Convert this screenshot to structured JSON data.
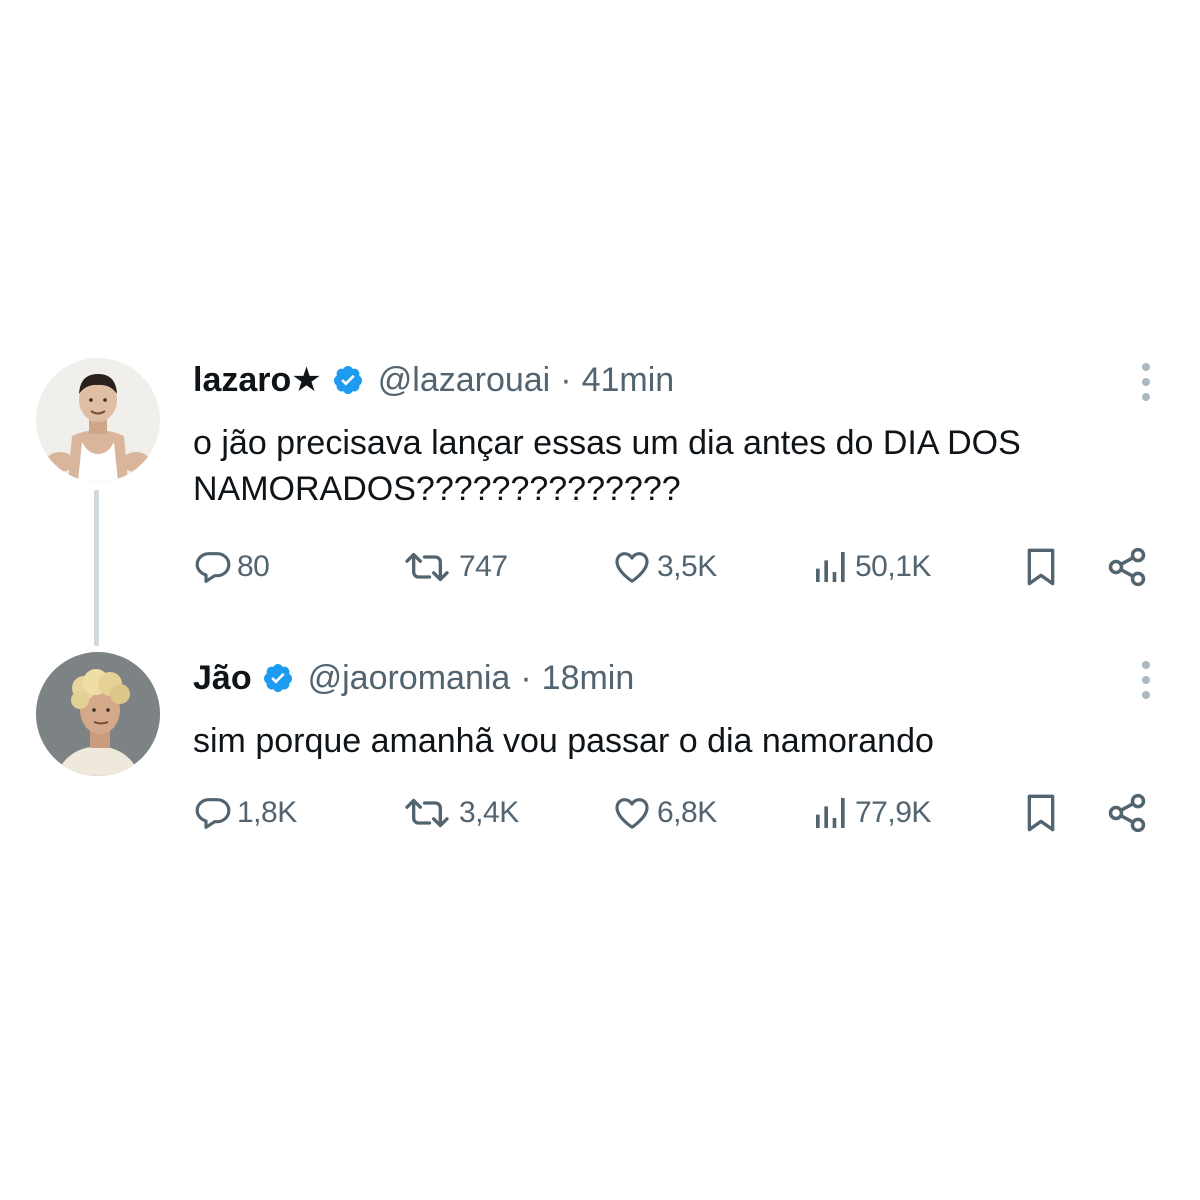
{
  "tweets": [
    {
      "name": "lazaro★",
      "handle": "@lazarouai",
      "separator": "·",
      "time": "41min",
      "text": "o jão precisava lançar essas um dia antes do DIA DOS NAMORADOS??????????????",
      "replies": "80",
      "retweets": "747",
      "likes": "3,5K",
      "views": "50,1K"
    },
    {
      "name": "Jão",
      "handle": "@jaoromania",
      "separator": "·",
      "time": "18min",
      "text": "sim porque amanhã vou passar o dia namorando",
      "replies": "1,8K",
      "retweets": "3,4K",
      "likes": "6,8K",
      "views": "77,9K"
    }
  ],
  "colors": {
    "text": "#0f1419",
    "secondary": "#536471",
    "verified": "#1d9bf0",
    "thread_line": "#cfd9de"
  },
  "icons": [
    "reply-icon",
    "retweet-icon",
    "like-icon",
    "views-icon",
    "bookmark-icon",
    "share-icon",
    "more-icon",
    "verified-badge-icon"
  ]
}
